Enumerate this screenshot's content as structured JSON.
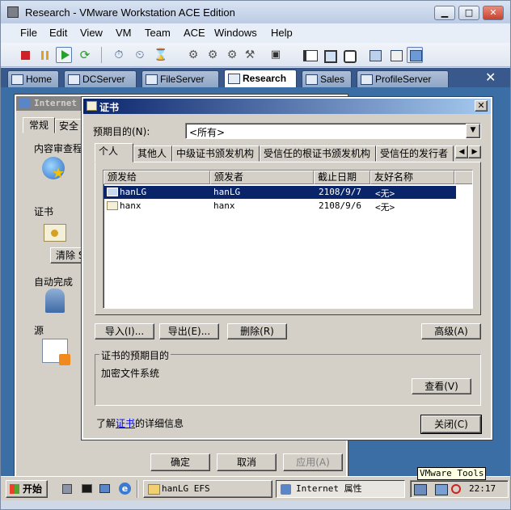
{
  "vm": {
    "title": "Research - VMware Workstation ACE Edition",
    "menu": [
      "File",
      "Edit",
      "View",
      "VM",
      "Team",
      "ACE",
      "Windows",
      "Help"
    ],
    "tabs": [
      {
        "label": "Home"
      },
      {
        "label": "DCServer"
      },
      {
        "label": "FileServer"
      },
      {
        "label": "Research",
        "active": true
      },
      {
        "label": "Sales"
      },
      {
        "label": "ProfileServer"
      }
    ],
    "tabs_close": "✕",
    "accent": "#39588c"
  },
  "inet": {
    "title": "Internet",
    "tabs": [
      "常规",
      "安全"
    ],
    "content_advisor": "内容审查程",
    "cert_group": "证书",
    "clear_btn": "清除 S",
    "autocomplete_group": "自动完成",
    "feeds_group": "源",
    "ok": "确定",
    "cancel": "取消",
    "apply": "应用(A)"
  },
  "cert_dialog": {
    "title": "证书",
    "purpose_label": "预期目的(N):",
    "purpose_value": "<所有>",
    "tabs": [
      "个人",
      "其他人",
      "中级证书颁发机构",
      "受信任的根证书颁发机构",
      "受信任的发行者"
    ],
    "columns": [
      "颁发给",
      "颁发者",
      "截止日期",
      "友好名称"
    ],
    "rows": [
      {
        "issued_to": "hanLG",
        "issued_by": "hanLG",
        "expires": "2108/9/7",
        "friendly": "<无>",
        "selected": true
      },
      {
        "issued_to": "hanx",
        "issued_by": "hanx",
        "expires": "2108/9/6",
        "friendly": "<无>",
        "selected": false
      }
    ],
    "import_btn": "导入(I)...",
    "export_btn": "导出(E)...",
    "remove_btn": "删除(R)",
    "advanced_btn": "高级(A)",
    "purposes_group": "证书的预期目的",
    "purposes_value": "加密文件系统",
    "view_btn": "查看(V)",
    "learn_prefix": "了解",
    "learn_link": "证书",
    "learn_suffix": "的详细信息",
    "close_btn": "关闭(C)"
  },
  "taskbar": {
    "start": "开始",
    "tasks": [
      "hanLG EFS",
      "Internet 属性"
    ],
    "clock": "22:17",
    "tooltip": "VMware Tools"
  }
}
